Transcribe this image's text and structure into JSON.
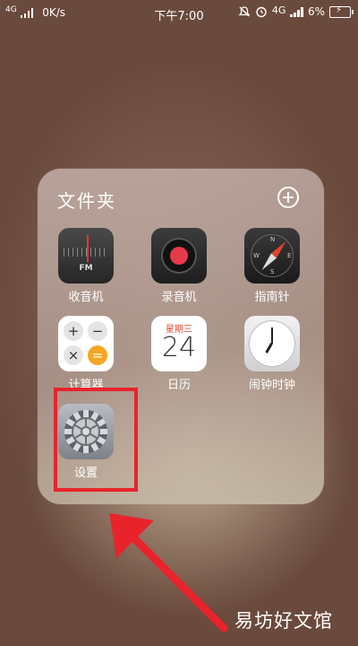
{
  "status_bar": {
    "network": "4G",
    "speed": "0K/s",
    "time": "下午7:00",
    "network_right": "4G",
    "battery": "6%"
  },
  "folder": {
    "title": "文件夹",
    "apps": [
      {
        "label": "收音机",
        "icon": "radio-icon"
      },
      {
        "label": "录音机",
        "icon": "recorder-icon"
      },
      {
        "label": "指南针",
        "icon": "compass-icon"
      },
      {
        "label": "计算器",
        "icon": "calculator-icon"
      },
      {
        "label": "日历",
        "icon": "calendar-icon",
        "weekday": "星期三",
        "day": "24"
      },
      {
        "label": "闹钟时钟",
        "icon": "clock-icon"
      },
      {
        "label": "设置",
        "icon": "settings-gear-icon"
      }
    ],
    "radio_text": "FM",
    "compass_letters": [
      "N",
      "E",
      "S",
      "W"
    ],
    "calc_keys": [
      "+",
      "−",
      "×",
      "="
    ]
  },
  "highlight_color": "#e8232b",
  "watermark": "易坊好文馆"
}
